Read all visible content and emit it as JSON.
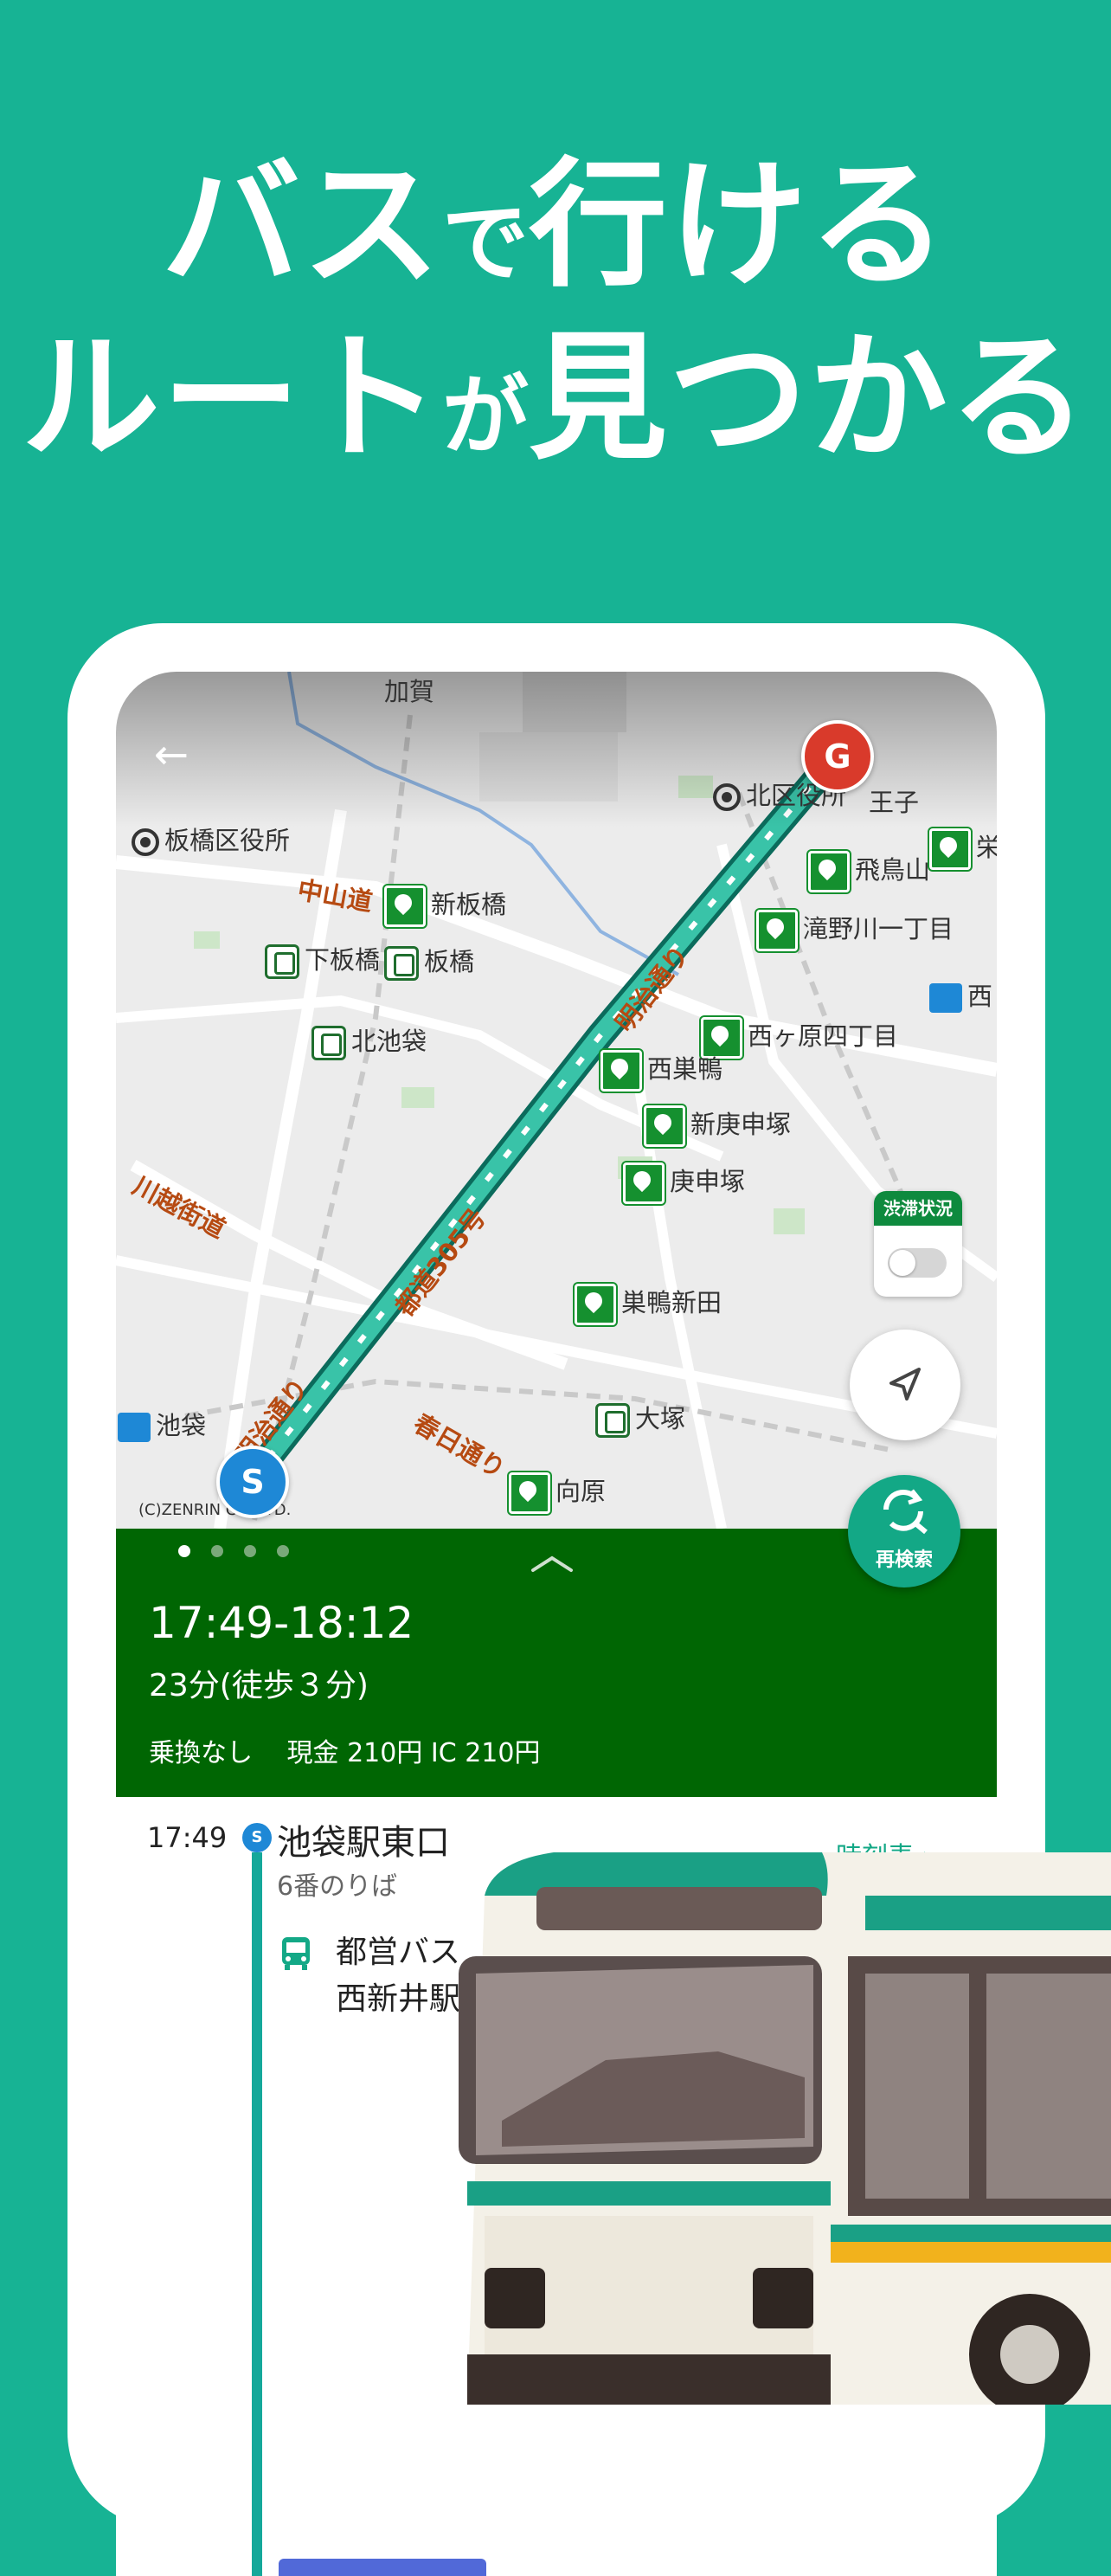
{
  "headline": {
    "line1_a": "バス",
    "line1_b": "で",
    "line1_c": "行ける",
    "line2_a": "ルート",
    "line2_b": "が",
    "line2_c": "見つかる"
  },
  "map": {
    "labels": {
      "kaga": "加賀",
      "itabashi_office": "板橋区役所",
      "kita_office": "北区役所",
      "oji": "王子",
      "nakasendo": "中山道",
      "shin_itabashi": "新板橋",
      "shimo_itabashi": "下板橋",
      "itabashi": "板橋",
      "kita_ikebukuro": "北池袋",
      "kawagoe_kaido": "川越街道",
      "asukayama": "飛鳥山",
      "takino": "滝野川一丁目",
      "nishigahara": "西ヶ原四丁目",
      "nishisugamo": "西巣鴨",
      "shinkoshinzuka": "新庚申塚",
      "koshinzuka": "庚申塚",
      "sugamo_shinden": "巣鴨新田",
      "otsuka": "大塚",
      "mukohara": "向原",
      "ikebukuro": "池袋",
      "kasuga_dori": "春日通り",
      "meiji_dori_1": "明治通り",
      "meiji_dori_2": "明治通り",
      "route_305": "都道305号",
      "sakae": "栄",
      "nishi": "西",
      "copyright": "(C)ZENRIN CO.,LTD."
    },
    "pins": {
      "start": "S",
      "goal": "G"
    },
    "traffic_label": "渋滞状況",
    "research_label": "再検索"
  },
  "summary": {
    "time_range": "17:49-18:12",
    "duration": "23分(徒歩３分)",
    "fare": "乗換なし　 現金 210円 IC 210円",
    "page_dots": 4,
    "active_dot": 0
  },
  "route": {
    "departure_time": "17:49",
    "stop_marker": "S",
    "stop_name": "池袋駅東口",
    "platform": "6番のりば",
    "timetable_link": "時刻表 ›",
    "bus_line": "都営バス",
    "bus_destination": "西新井駅"
  },
  "colors": {
    "background": "#17b394",
    "summary_bg": "#006603",
    "accent": "#13a886",
    "start_pin": "#1e88d6",
    "goal_pin": "#d93a2b"
  }
}
